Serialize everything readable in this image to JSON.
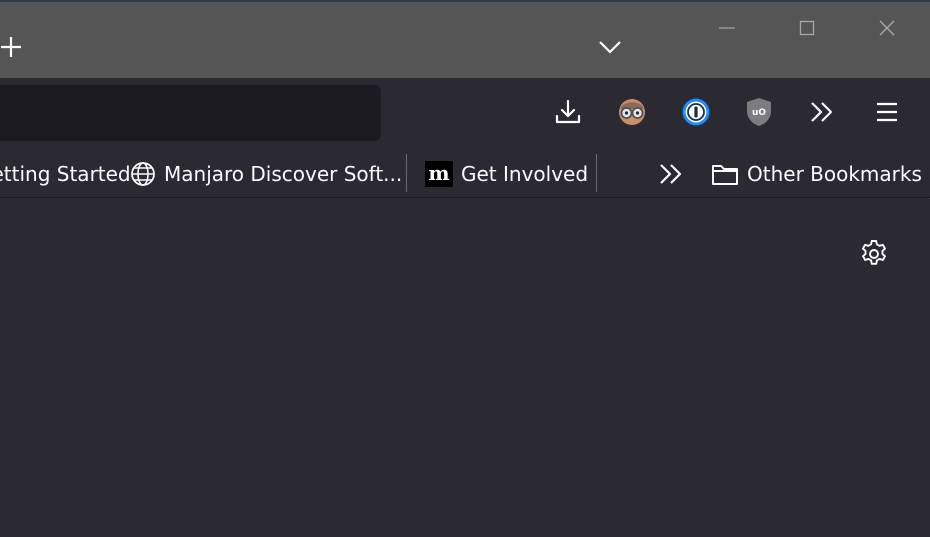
{
  "tabstrip": {
    "new_tab_icon": "plus-icon",
    "list_tabs_icon": "chevron-down-icon"
  },
  "window_controls": {
    "minimize_icon": "minimize-icon",
    "maximize_icon": "maximize-icon",
    "close_icon": "close-icon"
  },
  "toolbar": {
    "url_value": "",
    "buttons": [
      {
        "name": "downloads",
        "icon": "download-icon"
      },
      {
        "name": "extension-privacy",
        "icon": "spectacles-face-icon"
      },
      {
        "name": "extension-1password",
        "icon": "1password-icon"
      },
      {
        "name": "extension-ublock",
        "icon": "ublock-origin-icon"
      },
      {
        "name": "overflow",
        "icon": "double-chevron-icon"
      },
      {
        "name": "menu",
        "icon": "hamburger-icon"
      }
    ]
  },
  "bookmarks": {
    "items": [
      {
        "label": "Getting Started",
        "icon": "firefox-icon"
      },
      {
        "label": "Manjaro Discover Soft...",
        "icon": "globe-icon"
      },
      {
        "label": "Get Involved",
        "icon": "mdn-m-icon"
      }
    ],
    "more_icon": "double-chevron-icon",
    "other_label": "Other Bookmarks",
    "other_icon": "folder-icon"
  },
  "content": {
    "settings_icon": "gear-icon"
  },
  "colors": {
    "tabstrip": "#555555",
    "toolbar": "#2b2a33",
    "urlbar": "#1c1b22",
    "text": "#fbfbfe",
    "onepassword_blue": "#1a8cff",
    "ublock_gray": "#7d7d7d"
  }
}
